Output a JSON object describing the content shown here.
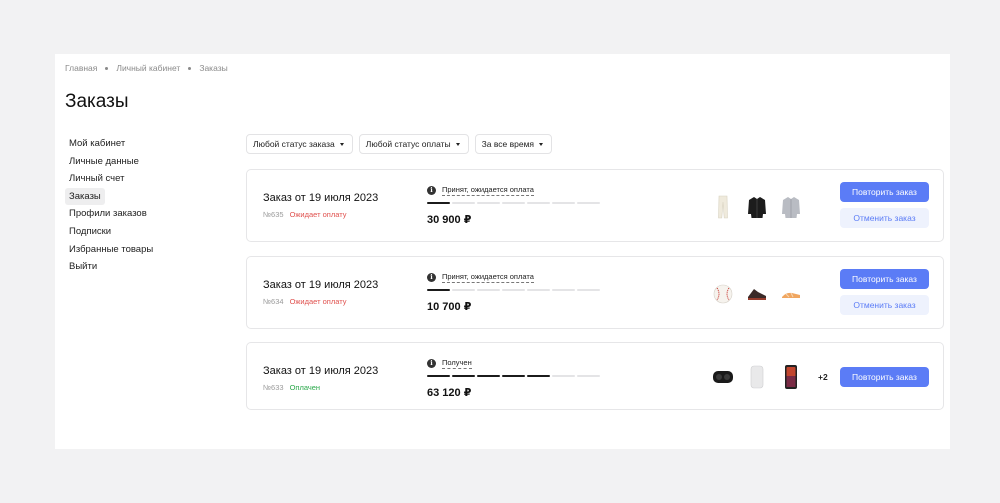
{
  "breadcrumb": [
    "Главная",
    "Личный кабинет",
    "Заказы"
  ],
  "page_title": "Заказы",
  "sidebar": {
    "items": [
      {
        "label": "Мой кабинет"
      },
      {
        "label": "Личные данные"
      },
      {
        "label": "Личный счет"
      },
      {
        "label": "Заказы",
        "active": true
      },
      {
        "label": "Профили заказов"
      },
      {
        "label": "Подписки"
      },
      {
        "label": "Избранные товары"
      },
      {
        "label": "Выйти"
      }
    ]
  },
  "filters": {
    "order_status": "Любой статус заказа",
    "payment_status": "Любой статус оплаты",
    "period": "За все время"
  },
  "colors": {
    "accent": "#5b7cf6",
    "pending": "#e0524f",
    "paid": "#2aa84a"
  },
  "orders": [
    {
      "title": "Заказ от 19 июля 2023",
      "number": "№635",
      "payment_status": "Ожидает оплату",
      "status": "Принят, ожидается оплата",
      "progress_steps_done": 1,
      "progress_steps_total": 7,
      "price": "30 900 ₽",
      "thumbs": [
        "pants-icon",
        "jacket-icon",
        "shirt-icon"
      ],
      "extra": "",
      "repeat_label": "Повторить заказ",
      "cancel_label": "Отменить заказ"
    },
    {
      "title": "Заказ от 19 июля 2023",
      "number": "№634",
      "payment_status": "Ожидает оплату",
      "status": "Принят, ожидается оплата",
      "progress_steps_done": 1,
      "progress_steps_total": 7,
      "price": "10 700 ₽",
      "thumbs": [
        "baseball-icon",
        "sneaker-icon",
        "sandal-icon"
      ],
      "extra": "",
      "repeat_label": "Повторить заказ",
      "cancel_label": "Отменить заказ"
    },
    {
      "title": "Заказ от 19 июля 2023",
      "number": "№633",
      "payment_status": "Оплачен",
      "status": "Получен",
      "progress_steps_done": 5,
      "progress_steps_total": 7,
      "price": "63 120 ₽",
      "thumbs": [
        "earbuds-icon",
        "speaker-icon",
        "phone-icon"
      ],
      "extra": "+2",
      "repeat_label": "Повторить заказ"
    }
  ]
}
